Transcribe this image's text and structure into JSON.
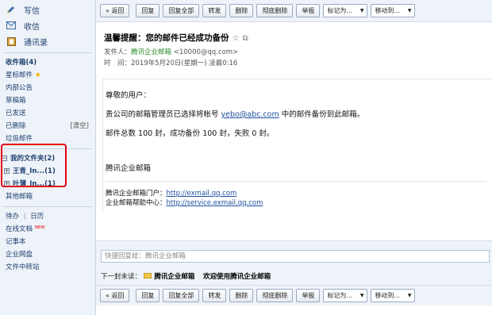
{
  "sidebar": {
    "compose": "写信",
    "inbox": "收信",
    "contacts": "通讯录",
    "items": [
      {
        "label": "收件箱(4)",
        "bold": true
      },
      {
        "label": "星标邮件",
        "star": true
      },
      {
        "label": "内部公告"
      },
      {
        "label": "草稿箱"
      },
      {
        "label": "已发送"
      },
      {
        "label": "已删除",
        "right": "[清空]"
      },
      {
        "label": "垃圾邮件"
      }
    ],
    "my_folders": "我的文件夹(2)",
    "folders": [
      "王青_In...(1)",
      "叶薄_In...(1)"
    ],
    "other_mailbox": "其他邮箱",
    "tools": [
      {
        "label": "待办",
        "extra": "日历"
      },
      {
        "label": "在线文档",
        "badge": "NEW"
      },
      {
        "label": "记事本"
      },
      {
        "label": "企业网盘"
      },
      {
        "label": "文件中转站"
      }
    ]
  },
  "toolbar": {
    "back": "« 返回",
    "reply": "回复",
    "reply_all": "回复全部",
    "forward": "转发",
    "delete": "删除",
    "perm_delete": "彻底删除",
    "report": "举报",
    "mark_as": "标记为...",
    "move_to": "移动到..."
  },
  "mail": {
    "subject": "温馨提醒：您的邮件已经成功备份",
    "sender_label": "发件人：",
    "sender_name": "腾讯企业邮箱",
    "sender_addr": "<10000@qq.com>",
    "time_label": "时　间：",
    "time_value": "2019年5月20日(星期一) 凌晨0:16",
    "greeting": "尊敬的用户：",
    "line1_pre": "贵公司的邮箱管理员已选择将帐号",
    "line1_link": "yebo@abc.com",
    "line1_post": "中的邮件备份到此邮箱。",
    "line2": "邮件总数 100 封，成功备份 100 封，失败 0 封。",
    "signature": "腾讯企业邮箱",
    "portal_label": "腾讯企业邮箱门户：",
    "portal_link": "http://exmail.qq.com",
    "help_label": "企业邮箱帮助中心：",
    "help_link": "http://service.exmail.qq.com"
  },
  "quick_reply": {
    "placeholder": "快捷回复给：腾讯企业邮箱"
  },
  "next_mail": {
    "label": "下一封未读：",
    "sender": "腾讯企业邮箱",
    "subject": "欢迎使用腾讯企业邮箱"
  }
}
